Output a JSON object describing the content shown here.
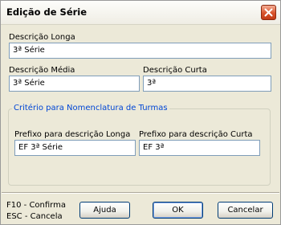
{
  "window": {
    "title": "Edição de Série"
  },
  "fields": {
    "descricao_longa": {
      "label": "Descrição Longa",
      "value": "3ª Série"
    },
    "descricao_media": {
      "label": "Descrição Média",
      "value": "3ª Série"
    },
    "descricao_curta": {
      "label": "Descrição Curta",
      "value": "3ª"
    }
  },
  "group": {
    "title": "Critério para Nomenclatura de Turmas",
    "prefixo_longa": {
      "label": "Prefixo para descrição Longa",
      "value": "EF 3ª Série"
    },
    "prefixo_curta": {
      "label": "Prefixo para descrição Curta",
      "value": "EF 3ª"
    }
  },
  "footer": {
    "hint_confirm": "F10 - Confirma",
    "hint_cancel": "ESC - Cancela",
    "help_label": "Ajuda",
    "ok_label": "OK",
    "cancel_label": "Cancelar"
  },
  "colors": {
    "group_title": "#0046d5",
    "close_button": "#d8532b"
  },
  "icons": {
    "close": "close-icon"
  }
}
